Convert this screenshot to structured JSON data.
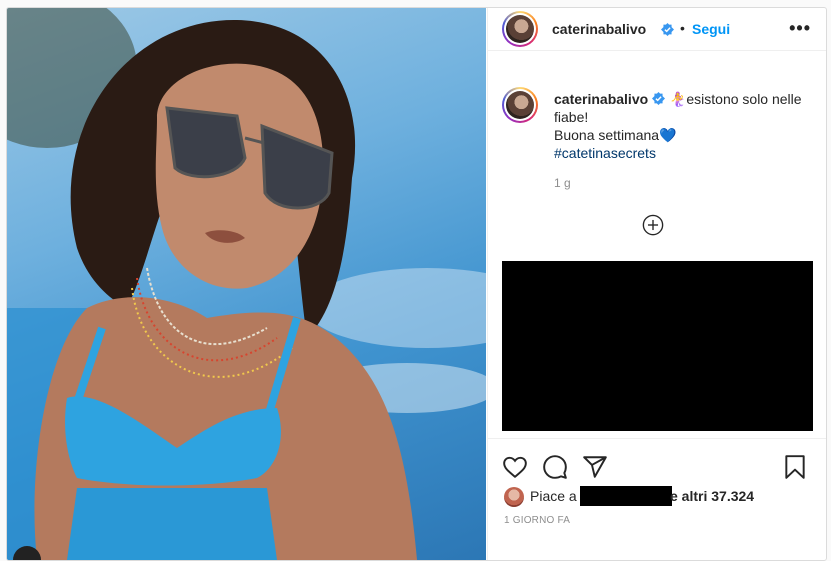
{
  "post": {
    "author": {
      "username": "caterinabalivo",
      "verified": true,
      "follow_label": "Segui",
      "separator": "•"
    },
    "menu_icon": "more-horizontal-icon",
    "caption": {
      "username": "caterinabalivo",
      "emoji": "🧜‍♀️",
      "line1": "esistono solo nelle fiabe!",
      "line2": "Buona settimana",
      "heart": "💙",
      "hashtag": "#catetinasecrets",
      "time": "1 g"
    },
    "load_more_icon": "plus-circle-icon",
    "actions": {
      "icons": [
        "heart-icon",
        "comment-icon",
        "share-icon",
        "bookmark-icon"
      ]
    },
    "likes": {
      "prefix": "Piace a",
      "suffix": "e altri 37.324"
    },
    "date": "1 GIORNO FA"
  }
}
